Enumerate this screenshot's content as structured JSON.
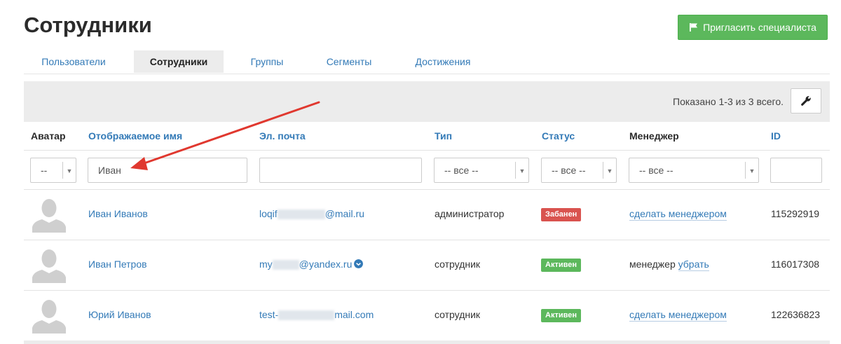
{
  "page": {
    "title": "Сотрудники"
  },
  "invite_button": {
    "label": "Пригласить специалиста",
    "icon": "flag-icon"
  },
  "tabs": [
    {
      "label": "Пользователи",
      "active": false
    },
    {
      "label": "Сотрудники",
      "active": true
    },
    {
      "label": "Группы",
      "active": false
    },
    {
      "label": "Сегменты",
      "active": false
    },
    {
      "label": "Достижения",
      "active": false
    }
  ],
  "toolbar": {
    "shown_text": "Показано 1-3 из 3 всего.",
    "settings_icon": "wrench-icon"
  },
  "columns": {
    "avatar": "Аватар",
    "display_name": "Отображаемое имя",
    "email": "Эл. почта",
    "type": "Тип",
    "status": "Статус",
    "manager": "Менеджер",
    "id": "ID"
  },
  "filters": {
    "avatar_select": "--",
    "name_input": "Иван",
    "email_input": "",
    "type_select": "-- все --",
    "status_select": "-- все --",
    "manager_select": "-- все --",
    "id_input": ""
  },
  "rows": [
    {
      "name": "Иван Иванов",
      "email_start": "loqif",
      "email_end": "@mail.ru",
      "verified": false,
      "type": "администратор",
      "status": "Забанен",
      "status_color": "#d9534f",
      "manager_prefix": "",
      "manager_link": "сделать менеджером",
      "id": "115292919"
    },
    {
      "name": "Иван Петров",
      "email_start": "my",
      "email_end": "@yandex.ru",
      "verified": true,
      "type": "сотрудник",
      "status": "Активен",
      "status_color": "#5cb85c",
      "manager_prefix": "менеджер",
      "manager_link": "убрать",
      "id": "116017308"
    },
    {
      "name": "Юрий Иванов",
      "email_start": "test-",
      "email_end": "mail.com",
      "verified": false,
      "type": "сотрудник",
      "status": "Активен",
      "status_color": "#5cb85c",
      "manager_prefix": "",
      "manager_link": "сделать менеджером",
      "id": "122636823"
    }
  ],
  "colors": {
    "accent": "#337ab7",
    "success": "#5cb85c",
    "danger": "#d9534f",
    "annotation_arrow": "#e0382f"
  }
}
